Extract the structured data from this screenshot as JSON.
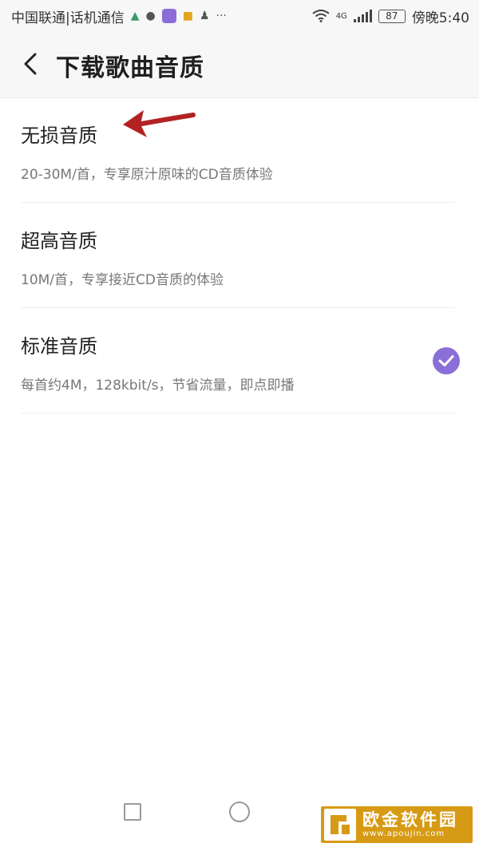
{
  "status_bar": {
    "carrier": "中国联通|话机通信",
    "network_badge": "4G",
    "battery": "87",
    "time": "傍晚5:40",
    "icons": [
      "notification-icon",
      "chat-icon",
      "app-icon",
      "folder-icon",
      "person-icon",
      "more-icon",
      "wifi-icon",
      "signal-icon",
      "battery-icon"
    ]
  },
  "header": {
    "title": "下载歌曲音质",
    "back_icon": "chevron-left-icon"
  },
  "options": [
    {
      "title": "无损音质",
      "desc": "20-30M/首，专享原汁原味的CD音质体验",
      "selected": false
    },
    {
      "title": "超高音质",
      "desc": "10M/首，专享接近CD音质的体验",
      "selected": false
    },
    {
      "title": "标准音质",
      "desc": "每首约4M，128kbit/s，节省流量，即点即播",
      "selected": true
    }
  ],
  "colors": {
    "accent": "#8b6fd8",
    "annotation_arrow": "#b22222",
    "watermark_bg": "#d79a14"
  },
  "watermark": {
    "title": "欧金软件园",
    "url": "www.apoujin.com"
  }
}
